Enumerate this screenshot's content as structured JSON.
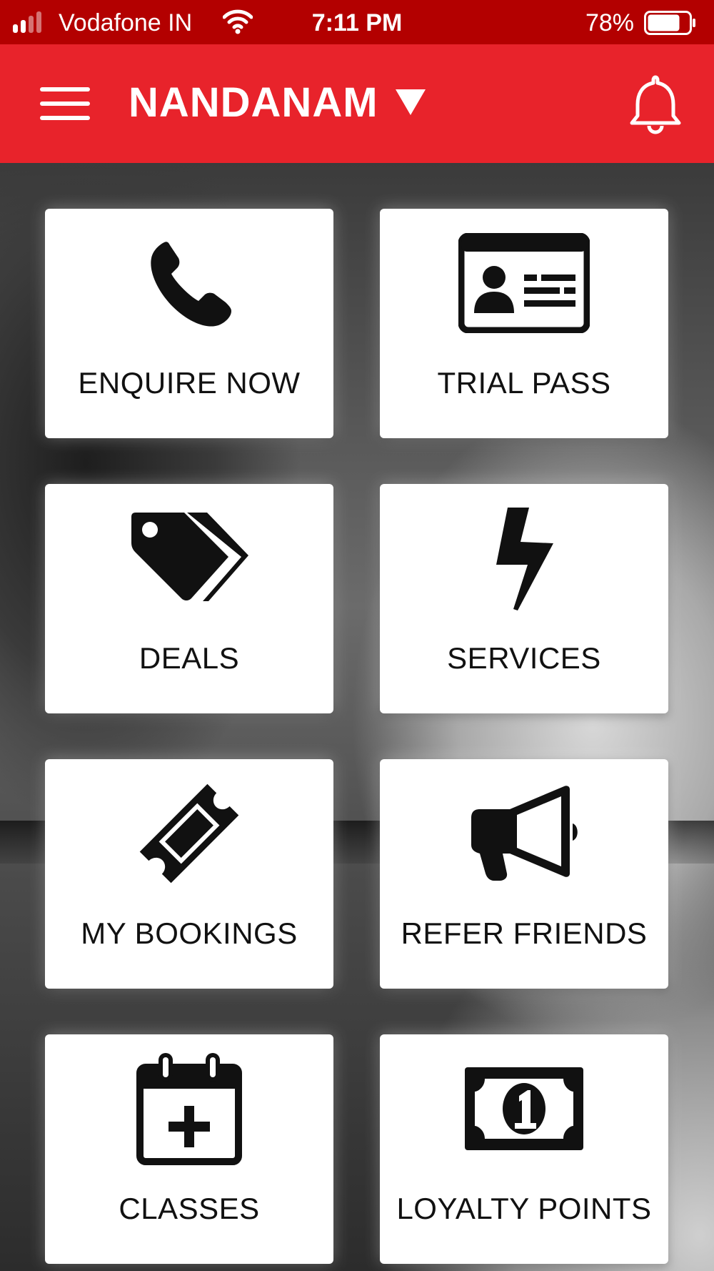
{
  "status_bar": {
    "carrier": "Vodafone IN",
    "time": "7:11 PM",
    "battery": "78%",
    "signal_bars_active": 2,
    "signal_bars_total": 4,
    "battery_level": 0.78,
    "color": "#b30000"
  },
  "header": {
    "location": "NANDANAM",
    "color": "#e8232b",
    "icons": {
      "menu": "hamburger-menu-icon",
      "dropdown": "triangle-down-icon",
      "notifications": "bell-icon"
    }
  },
  "tiles": [
    {
      "label": "ENQUIRE NOW",
      "icon": "phone-icon"
    },
    {
      "label": "TRIAL PASS",
      "icon": "id-card-icon"
    },
    {
      "label": "DEALS",
      "icon": "price-tags-icon"
    },
    {
      "label": "SERVICES",
      "icon": "lightning-bolt-icon"
    },
    {
      "label": "MY BOOKINGS",
      "icon": "ticket-icon"
    },
    {
      "label": "REFER FRIENDS",
      "icon": "megaphone-icon"
    },
    {
      "label": "CLASSES",
      "icon": "calendar-add-icon"
    },
    {
      "label": "LOYALTY POINTS",
      "icon": "banknote-icon"
    }
  ]
}
